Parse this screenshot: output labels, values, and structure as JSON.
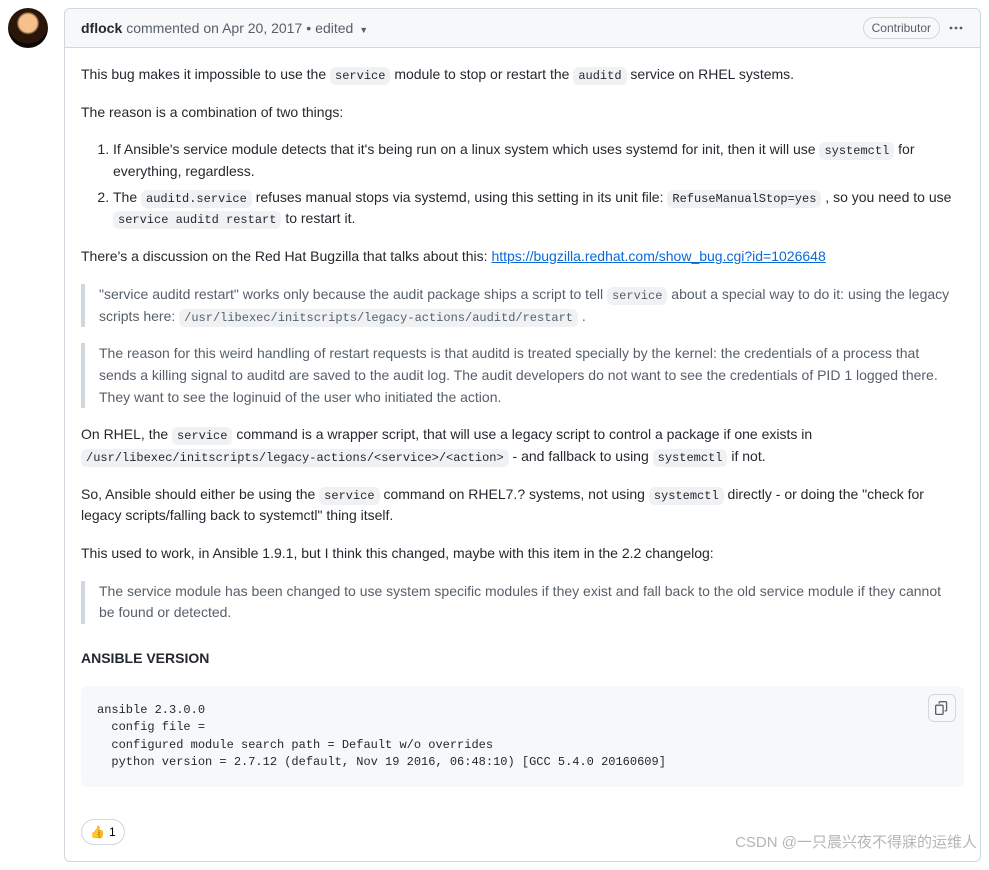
{
  "header": {
    "author": "dflock",
    "commented_text": "commented",
    "date_text": "on Apr 20, 2017",
    "separator": "•",
    "edited_text": "edited",
    "badge": "Contributor"
  },
  "body": {
    "p1_pre": "This bug makes it impossible to use the ",
    "p1_code1": "service",
    "p1_mid": " module to stop or restart the ",
    "p1_code2": "auditd",
    "p1_post": " service on RHEL systems.",
    "p2": "The reason is a combination of two things:",
    "li1_pre": "If Ansible's service module detects that it's being run on a linux system which uses systemd for init, then it will use ",
    "li1_code": "systemctl",
    "li1_post": " for everything, regardless.",
    "li2_pre": "The ",
    "li2_code1": "auditd.service",
    "li2_mid": " refuses manual stops via systemd, using this setting in its unit file: ",
    "li2_code2": "RefuseManualStop=yes",
    "li2_mid2": " , so you need to use ",
    "li2_code3": "service auditd restart",
    "li2_post": " to restart it.",
    "p3_pre": "There's a discussion on the Red Hat Bugzilla that talks about this: ",
    "p3_link": "https://bugzilla.redhat.com/show_bug.cgi?id=1026648",
    "bq1_pre": "\"service auditd restart\" works only because the audit package ships a script to tell ",
    "bq1_code1": "service",
    "bq1_mid": " about a special way to do it: using the legacy scripts here: ",
    "bq1_code2": "/usr/libexec/initscripts/legacy-actions/auditd/restart",
    "bq1_post": " .",
    "bq2": "The reason for this weird handling of restart requests is that auditd is treated specially by the kernel: the credentials of a process that sends a killing signal to auditd are saved to the audit log. The audit developers do not want to see the credentials of PID 1 logged there. They want to see the loginuid of the user who initiated the action.",
    "p4_pre": "On RHEL, the ",
    "p4_code1": "service",
    "p4_mid": " command is a wrapper script, that will use a legacy script to control a package if one exists in ",
    "p4_code2": "/usr/libexec/initscripts/legacy-actions/<service>/<action>",
    "p4_mid2": " - and fallback to using ",
    "p4_code3": "systemctl",
    "p4_post": " if not.",
    "p5_pre": "So, Ansible should either be using the ",
    "p5_code1": "service",
    "p5_mid": " command on RHEL7.? systems, not using ",
    "p5_code2": "systemctl",
    "p5_post": " directly - or doing the \"check for legacy scripts/falling back to systemctl\" thing itself.",
    "p6": "This used to work, in Ansible 1.9.1, but I think this changed, maybe with this item in the 2.2 changelog:",
    "bq3": "The service module has been changed to use system specific modules if they exist and fall back to the old service module if they cannot be found or detected.",
    "section_title": "ANSIBLE VERSION",
    "codeblock": "ansible 2.3.0.0\n  config file =\n  configured module search path = Default w/o overrides\n  python version = 2.7.12 (default, Nov 19 2016, 06:48:10) [GCC 5.4.0 20160609]"
  },
  "reaction": {
    "emoji": "👍",
    "count": "1"
  },
  "watermark": "CSDN @一只晨兴夜不得寐的运维人"
}
